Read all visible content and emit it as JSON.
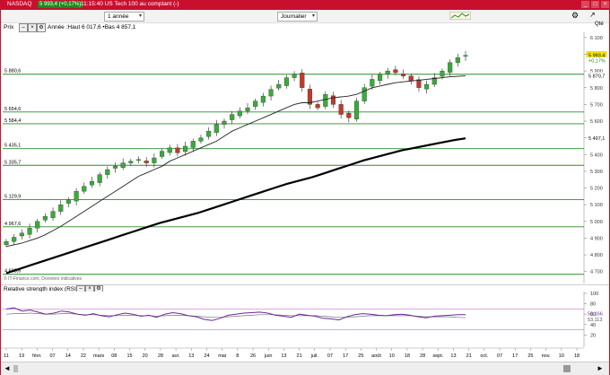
{
  "titlebar": {
    "symbol": "NASDAQ",
    "badge": "5 993,4 (+0,17%)",
    "subtitle": "11:15:40 US Tech 100 au comptant (-)",
    "buttons": [
      "_",
      "□",
      "×"
    ]
  },
  "toolbar": {
    "period": "1 année",
    "interval": "Journalier"
  },
  "info": {
    "prix_label": "Prix",
    "summary": "Année :Haut 6 017,6 •Bas 4 857,1",
    "rsi_label": "Relative strength index (RSI) (14)",
    "source": "© IT-Finance.com, Données indicatives",
    "qte": "Qté"
  },
  "price_axis": [
    "6 100",
    "6 000",
    "5 900",
    "5 800",
    "5 700",
    "5 600",
    "5 500",
    "5 400",
    "5 300",
    "5 200",
    "5 100",
    "5 000",
    "4 900",
    "4 800",
    "4 700"
  ],
  "price_tags": {
    "last": "5 993,4",
    "change": "+0,17%",
    "ma50": "5 870,7",
    "ma200": "5 497,1"
  },
  "levels": [
    "5 880,6",
    "5 654,6",
    "5 584,4",
    "5 435,1",
    "5 335,7",
    "5 129,9",
    "4 967,6",
    "4 683,6"
  ],
  "rsi_axis": [
    "100",
    "80",
    "60",
    "40",
    "20",
    "0"
  ],
  "rsi_tags": [
    "59,166",
    "53,113"
  ],
  "x_axis": [
    "11",
    "19",
    "févr.",
    "07",
    "14",
    "22",
    "mars",
    "08",
    "15",
    "20",
    "28",
    "avr.",
    "13",
    "24",
    "mai",
    "8",
    "26",
    "juin",
    "13",
    "21",
    "juil.",
    "07",
    "17",
    "25",
    "août",
    "10",
    "18",
    "28",
    "sept.",
    "13",
    "21",
    "oct.",
    "07",
    "17",
    "25",
    "nov.",
    "10",
    "18"
  ],
  "colors": {
    "frame": "#c8102e",
    "level_lines": "#2e8b2e",
    "up_candle": "#3aaa3a",
    "down_candle": "#c0392b",
    "rsi_line": "#6a2a9a",
    "ma": "#222222"
  },
  "chart_data": {
    "type": "candlestick",
    "approx_close": [
      4880,
      4905,
      4930,
      4960,
      5000,
      5030,
      5060,
      5100,
      5130,
      5180,
      5210,
      5240,
      5280,
      5310,
      5330,
      5350,
      5360,
      5370,
      5350,
      5380,
      5420,
      5440,
      5410,
      5450,
      5480,
      5500,
      5540,
      5580,
      5600,
      5640,
      5660,
      5680,
      5720,
      5750,
      5790,
      5820,
      5860,
      5880,
      5800,
      5700,
      5680,
      5760,
      5700,
      5640,
      5620,
      5720,
      5800,
      5850,
      5880,
      5900,
      5890,
      5870,
      5840,
      5800,
      5820,
      5860,
      5900,
      5950,
      5980,
      5993
    ],
    "ma50": [
      4850,
      4860,
      4870,
      4885,
      4900,
      4920,
      4945,
      4970,
      5000,
      5030,
      5060,
      5090,
      5120,
      5150,
      5180,
      5210,
      5240,
      5270,
      5290,
      5310,
      5330,
      5360,
      5380,
      5400,
      5420,
      5440,
      5460,
      5480,
      5510,
      5540,
      5560,
      5580,
      5600,
      5620,
      5640,
      5660,
      5680,
      5700,
      5710,
      5710,
      5720,
      5730,
      5740,
      5745,
      5750,
      5760,
      5780,
      5800,
      5810,
      5820,
      5830,
      5835,
      5840,
      5845,
      5850,
      5855,
      5860,
      5865,
      5868,
      5870.7
    ],
    "ma200": [
      4690,
      4715,
      4740,
      4765,
      4790,
      4815,
      4840,
      4865,
      4890,
      4915,
      4940,
      4965,
      4990,
      5010,
      5030,
      5050,
      5075,
      5100,
      5125,
      5150,
      5175,
      5200,
      5225,
      5245,
      5265,
      5290,
      5315,
      5340,
      5365,
      5385,
      5405,
      5425,
      5440,
      5455,
      5470,
      5485,
      5497.1
    ],
    "rsi": [
      70,
      72,
      66,
      68,
      64,
      60,
      62,
      66,
      64,
      60,
      58,
      61,
      57,
      55,
      59,
      62,
      60,
      56,
      58,
      54,
      60,
      63,
      61,
      57,
      55,
      50,
      48,
      52,
      58,
      60,
      62,
      63,
      64,
      62,
      58,
      56,
      54,
      60,
      58,
      56,
      52,
      51,
      49,
      55,
      59,
      61,
      60,
      58,
      57,
      59,
      60,
      58,
      55,
      53,
      56,
      57,
      58,
      59,
      59.166
    ],
    "rsi_signal": [
      60,
      61,
      61,
      62,
      61,
      60,
      60,
      61,
      61,
      60,
      59,
      59,
      58,
      57,
      57,
      58,
      58,
      57,
      57,
      56,
      57,
      58,
      58,
      57,
      56,
      55,
      54,
      54,
      55,
      56,
      57,
      58,
      59,
      59,
      59,
      58,
      57,
      57,
      57,
      57,
      56,
      55,
      54,
      54,
      55,
      56,
      57,
      57,
      57,
      57,
      57,
      57,
      56,
      55,
      55,
      55,
      55,
      54,
      53.113
    ],
    "ylim": [
      4650,
      6110
    ]
  }
}
